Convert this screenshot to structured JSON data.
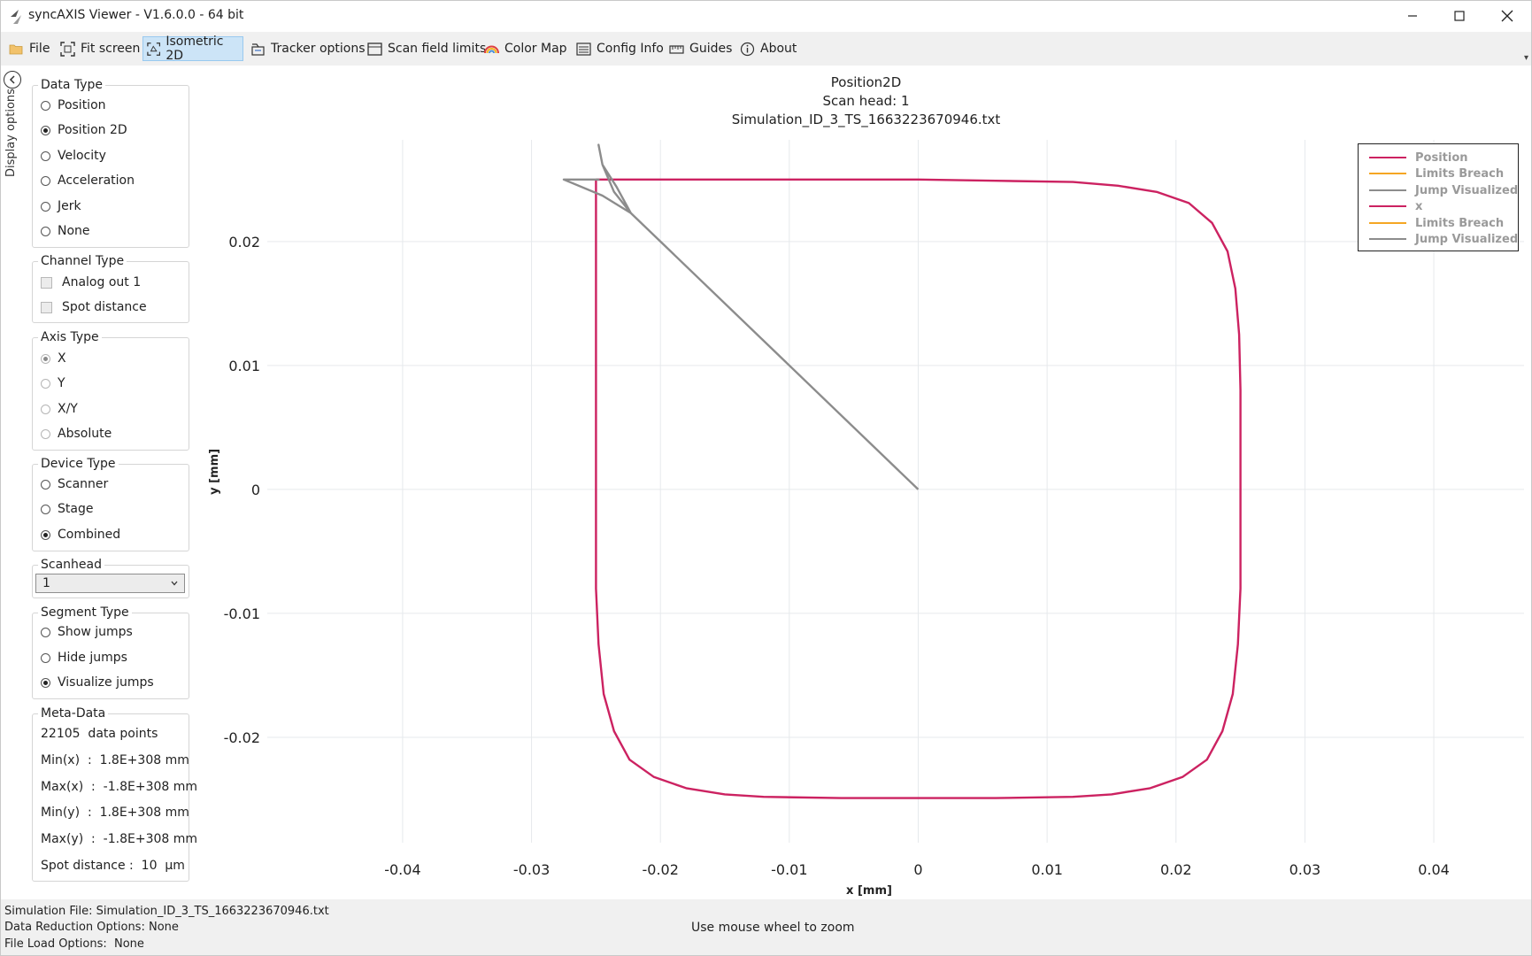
{
  "window": {
    "title": "syncAXIS Viewer - V1.6.0.0 - 64 bit"
  },
  "toolbar": {
    "items": [
      {
        "label": "File",
        "icon": "folder-icon"
      },
      {
        "label": "Fit screen",
        "icon": "fit-screen-icon"
      },
      {
        "label": "Isometric 2D",
        "icon": "isometric-icon",
        "active": true
      },
      {
        "label": "Tracker options",
        "icon": "tracker-icon"
      },
      {
        "label": "Scan field limits",
        "icon": "scan-field-icon"
      },
      {
        "label": "Color Map",
        "icon": "rainbow-icon"
      },
      {
        "label": "Config Info",
        "icon": "config-list-icon"
      },
      {
        "label": "Guides",
        "icon": "guides-icon"
      },
      {
        "label": "About",
        "icon": "info-icon"
      }
    ]
  },
  "sidebar": {
    "toggle_label": "Display options"
  },
  "panel": {
    "data_type": {
      "title": "Data Type",
      "options": [
        "Position",
        "Position 2D",
        "Velocity",
        "Acceleration",
        "Jerk",
        "None"
      ],
      "selected": "Position 2D"
    },
    "channel_type": {
      "title": "Channel Type",
      "options": [
        "Analog out 1",
        "Spot distance"
      ]
    },
    "axis_type": {
      "title": "Axis Type",
      "options": [
        "X",
        "Y",
        "X/Y",
        "Absolute"
      ],
      "selected": "X"
    },
    "device_type": {
      "title": "Device Type",
      "options": [
        "Scanner",
        "Stage",
        "Combined"
      ],
      "selected": "Combined"
    },
    "scanhead": {
      "title": "Scanhead",
      "value": "1"
    },
    "segment_type": {
      "title": "Segment Type",
      "options": [
        "Show jumps",
        "Hide jumps",
        "Visualize jumps"
      ],
      "selected": "Visualize jumps"
    },
    "meta": {
      "title": "Meta-Data",
      "lines": [
        "22105  data points",
        "Min(x)  :  1.8E+308 mm",
        "Max(x)  :  -1.8E+308 mm",
        "Min(y)  :  1.8E+308 mm",
        "Max(y)  :  -1.8E+308 mm",
        "Spot distance :  10  µm"
      ]
    }
  },
  "chart_data": {
    "type": "line",
    "title": "Position2D",
    "subtitle_lines": [
      "Scan head: 1",
      "Simulation_ID_3_TS_1663223670946.txt"
    ],
    "xlabel": "x [mm]",
    "ylabel": "y [mm]",
    "xlim": [
      -0.0505,
      0.047
    ],
    "ylim": [
      -0.0285,
      0.0282
    ],
    "x_ticks": [
      "-0.04",
      "-0.03",
      "-0.02",
      "-0.01",
      "0",
      "0.01",
      "0.02",
      "0.03",
      "0.04"
    ],
    "y_ticks": [
      "0.02",
      "0.01",
      "0",
      "-0.01",
      "-0.02"
    ],
    "grid": true,
    "legend_position": "top-right",
    "legend": [
      {
        "name": "Position",
        "color": "#cc2261"
      },
      {
        "name": "Limits Breach",
        "color": "#f5a623"
      },
      {
        "name": "Jump Visualized",
        "color": "#8c8c8c"
      },
      {
        "name": "x",
        "color": "#cc2261"
      },
      {
        "name": "Limits Breach",
        "color": "#f5a623"
      },
      {
        "name": "Jump Visualized",
        "color": "#8c8c8c"
      }
    ],
    "series": [
      {
        "name": "Position",
        "color": "#cc2261",
        "x": [
          -0.025,
          -0.025,
          -0.0248,
          -0.0244,
          -0.0236,
          -0.0224,
          -0.0205,
          -0.018,
          -0.015,
          -0.012,
          -0.006,
          0,
          0.006,
          0.012,
          0.015,
          0.018,
          0.0205,
          0.0224,
          0.0236,
          0.0244,
          0.0248,
          0.025,
          0.025,
          0.0249,
          0.0246,
          0.024,
          0.0228,
          0.021,
          0.0185,
          0.0155,
          0.012,
          0.006,
          0,
          -0.006,
          -0.012,
          -0.018,
          -0.0225,
          -0.025
        ],
        "y": [
          0.025,
          -0.008,
          -0.0125,
          -0.0165,
          -0.0195,
          -0.0218,
          -0.0232,
          -0.0241,
          -0.0246,
          -0.0248,
          -0.0249,
          -0.0249,
          -0.0249,
          -0.0248,
          -0.0246,
          -0.0241,
          -0.0232,
          -0.0218,
          -0.0195,
          -0.0165,
          -0.0125,
          -0.008,
          0.008,
          0.0125,
          0.0162,
          0.0192,
          0.0215,
          0.0231,
          0.024,
          0.0245,
          0.0248,
          0.0249,
          0.025,
          0.025,
          0.025,
          0.025,
          0.025,
          0.025
        ]
      },
      {
        "name": "Jump Visualized",
        "color": "#8c8c8c",
        "x": [
          0,
          -0.0223,
          -0.0236,
          -0.0245,
          -0.0248,
          -0.0245,
          -0.0234,
          -0.0223,
          -0.0245,
          -0.0275,
          -0.0248,
          -0.0248
        ],
        "y": [
          0,
          0.0223,
          0.024,
          0.0262,
          0.0278,
          0.0262,
          0.0244,
          0.0223,
          0.0237,
          0.025,
          0.025,
          0.0249
        ]
      }
    ]
  },
  "status": {
    "lines": [
      "Simulation File: Simulation_ID_3_TS_1663223670946.txt",
      "Data Reduction Options: None",
      "File Load Options:  None"
    ],
    "hint": "Use mouse wheel to zoom"
  }
}
